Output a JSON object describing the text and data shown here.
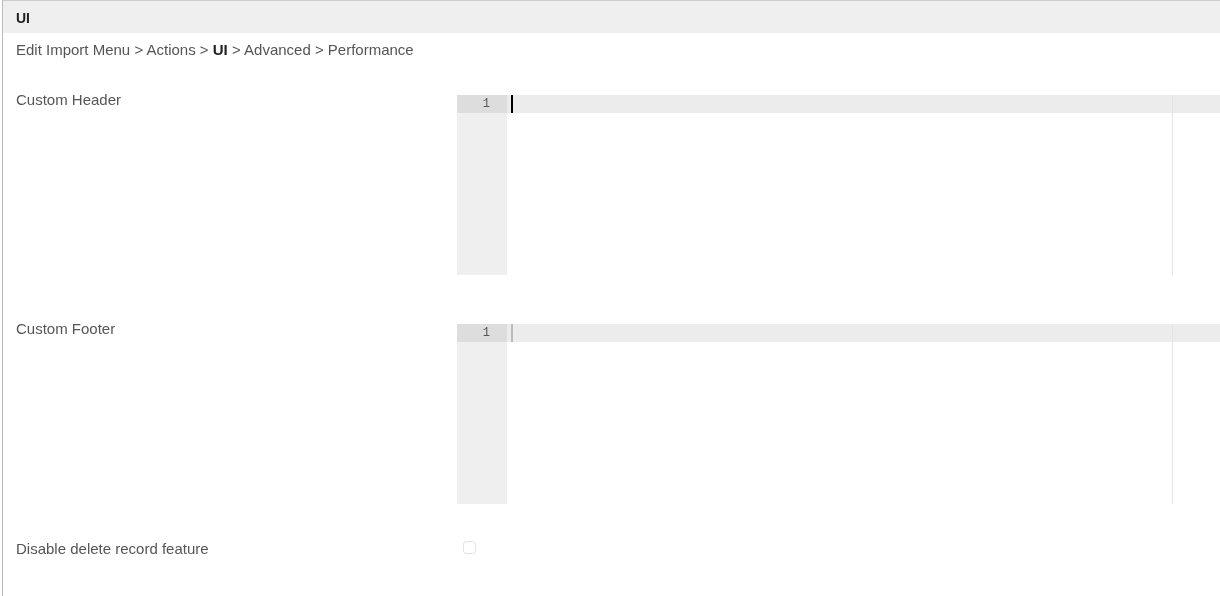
{
  "panel": {
    "title": "UI"
  },
  "breadcrumb": "Edit Import Menu > Actions > **UI** > Advanced > Performance",
  "editors": [
    {
      "label": "Custom Header",
      "line_numbers": [
        "1"
      ],
      "focused": true
    },
    {
      "label": "Custom Footer",
      "line_numbers": [
        "1"
      ],
      "focused": false
    }
  ],
  "checkbox": {
    "label": "Disable delete record feature",
    "checked": false
  }
}
